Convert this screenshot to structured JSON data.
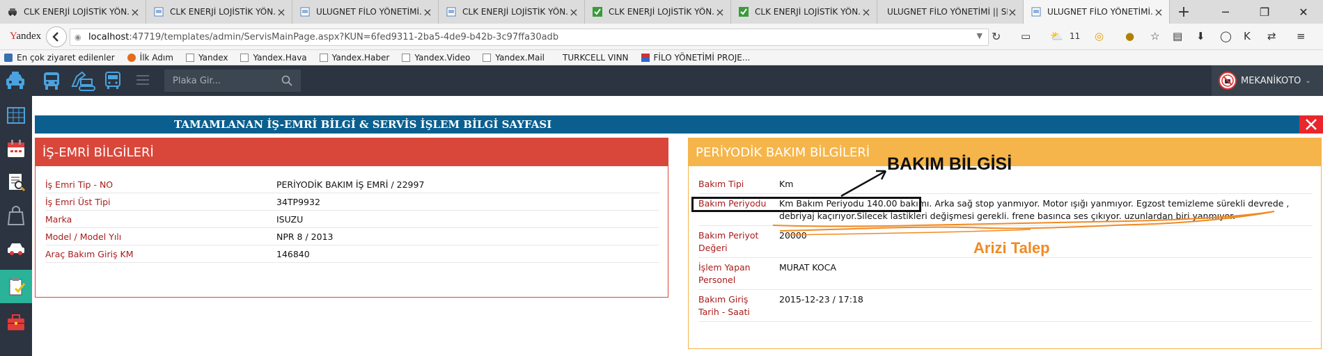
{
  "browser": {
    "tabs": [
      {
        "title": "CLK ENERJİ LOJİSTİK YÖN...",
        "icon": "car-icon",
        "active": false
      },
      {
        "title": "CLK ENERJİ LOJİSTİK YÖN...",
        "icon": "page-icon",
        "active": false
      },
      {
        "title": "ULUGNET FİLO YÖNETİMİ...",
        "icon": "page-icon",
        "active": false
      },
      {
        "title": "CLK ENERJİ LOJİSTİK YÖN...",
        "icon": "page-icon",
        "active": false
      },
      {
        "title": "CLK ENERJİ LOJİSTİK YÖN...",
        "icon": "check-icon",
        "active": false
      },
      {
        "title": "CLK ENERJİ LOJİSTİK YÖN...",
        "icon": "check-icon",
        "active": false
      },
      {
        "title": "ULUGNET FİLO YÖNETİMİ || SE...",
        "icon": "none",
        "active": false
      },
      {
        "title": "ULUGNET FİLO YÖNETİMİ...",
        "icon": "page-icon",
        "active": true
      }
    ],
    "brand": "Yandex",
    "url_host": "localhost",
    "url_rest": ":47719/templates/admin/ServisMainPage.aspx?KUN=6fed9311-2ba5-4de9-b42b-3c97ffa30adb",
    "weather_temp": "11",
    "bookmarks": [
      {
        "label": "En çok ziyaret edilenler",
        "icon": "gear-icon"
      },
      {
        "label": "İlk Adım",
        "icon": "firefox-icon"
      },
      {
        "label": "Yandex",
        "icon": "doc-icon"
      },
      {
        "label": "Yandex.Hava",
        "icon": "doc-icon"
      },
      {
        "label": "Yandex.Haber",
        "icon": "doc-icon"
      },
      {
        "label": "Yandex.Video",
        "icon": "doc-icon"
      },
      {
        "label": "Yandex.Mail",
        "icon": "doc-icon"
      },
      {
        "label": "TURKCELL VINN",
        "icon": "none"
      },
      {
        "label": "FİLO YÖNETİMİ PROJE...",
        "icon": "flag-icon"
      }
    ]
  },
  "app": {
    "search_placeholder": "Plaka Gir...",
    "user_name": "MEKANİKOTO",
    "page_title": "TAMAMLANAN İŞ-EMRİ BİLGİ & SERVİS İŞLEM BİLGİ SAYFASI",
    "colors": {
      "header": "#2b3440",
      "title_bar": "#0b5f8f",
      "left_panel": "#d9473b",
      "right_panel": "#f6b54a",
      "active_sidebar": "#2bb39a"
    }
  },
  "work_order": {
    "heading": "İŞ-EMRİ BİLGİLERİ",
    "rows": [
      {
        "label": "İş Emri Tip - NO",
        "value": "PERİYODİK BAKIM İŞ EMRİ / 22997"
      },
      {
        "label": "İş Emri Üst Tipi",
        "value": "34TP9932"
      },
      {
        "label": "Marka",
        "value": "ISUZU"
      },
      {
        "label": "Model / Model Yılı",
        "value": "NPR 8 / 2013"
      },
      {
        "label": "Araç Bakım Giriş KM",
        "value": "146840"
      }
    ]
  },
  "maintenance": {
    "heading": "PERİYODİK BAKIM BİLGİLERİ",
    "rows": [
      {
        "label": "Bakım Tipi",
        "value": "Km"
      },
      {
        "label": "Bakım Periyodu",
        "value": "Km Bakım Periyodu 140.00 bakımı. Arka sağ stop yanmıyor. Motor ışığı yanmıyor. Egzost temizleme sürekli devrede , debriyaj kaçırıyor.Silecek lastikleri değişmesi gerekli. frene basınca ses çıkıyor. uzunlardan biri yanmıyor."
      },
      {
        "label": "Bakım Periyot Değeri",
        "value": "20000"
      },
      {
        "label": "İşlem Yapan Personel",
        "value": "MURAT KOCA"
      },
      {
        "label": "Bakım Giriş Tarih - Saati",
        "value": "2015-12-23 / 17:18"
      }
    ]
  },
  "annotations": {
    "bakim_label": "BAKIM BİLGİSİ",
    "arizi_label": "Arizi Talep"
  }
}
